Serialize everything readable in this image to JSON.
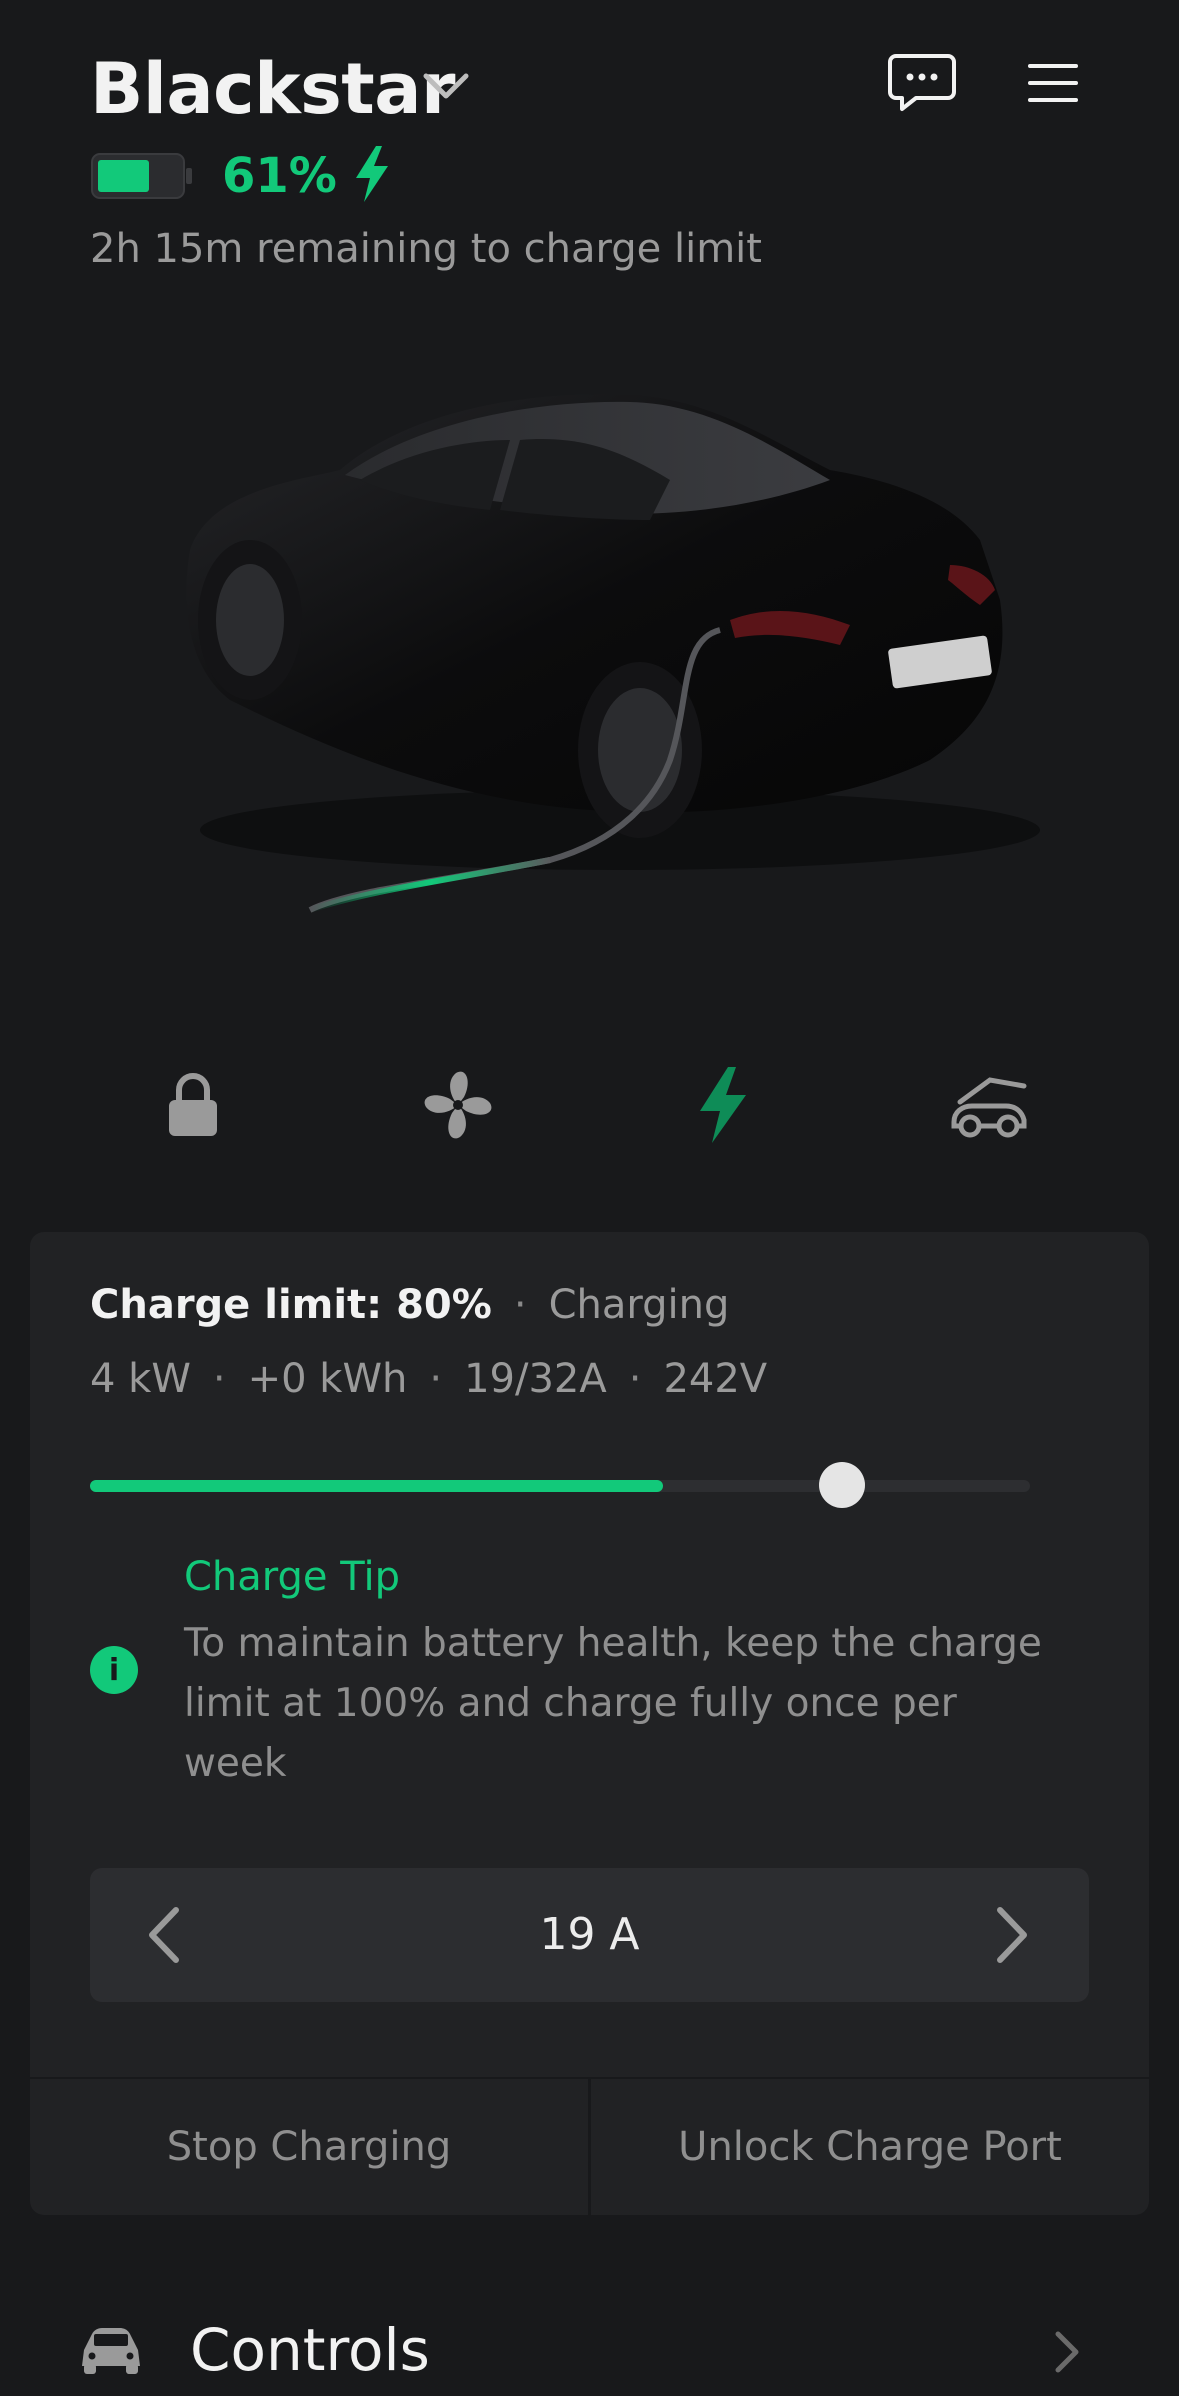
{
  "header": {
    "vehicle_name": "Blackstar",
    "battery_percent_text": "61%",
    "battery_level": 0.61,
    "remaining_text": "2h 15m remaining to charge limit",
    "icons": [
      "chevron-down-icon",
      "message-icon",
      "menu-icon",
      "battery-icon",
      "bolt-icon"
    ]
  },
  "quick_actions": [
    {
      "name": "lock-icon"
    },
    {
      "name": "fan-icon"
    },
    {
      "name": "bolt-icon"
    },
    {
      "name": "trunk-icon"
    }
  ],
  "charging": {
    "limit_label": "Charge limit: 80%",
    "status": "Charging",
    "power": "4 kW",
    "energy_added": "+0 kWh",
    "current": "19/32A",
    "voltage": "242V",
    "level_fraction": 0.61,
    "limit_fraction": 0.8,
    "tip_title": "Charge Tip",
    "tip_body": "To maintain battery health, keep the charge limit at 100% and charge fully once per week",
    "amps_value": "19 A",
    "stop_label": "Stop Charging",
    "unlock_label": "Unlock Charge Port"
  },
  "controls": {
    "label": "Controls"
  },
  "colors": {
    "accent": "#12c97a",
    "background": "#18191b",
    "panel": "#212224"
  }
}
